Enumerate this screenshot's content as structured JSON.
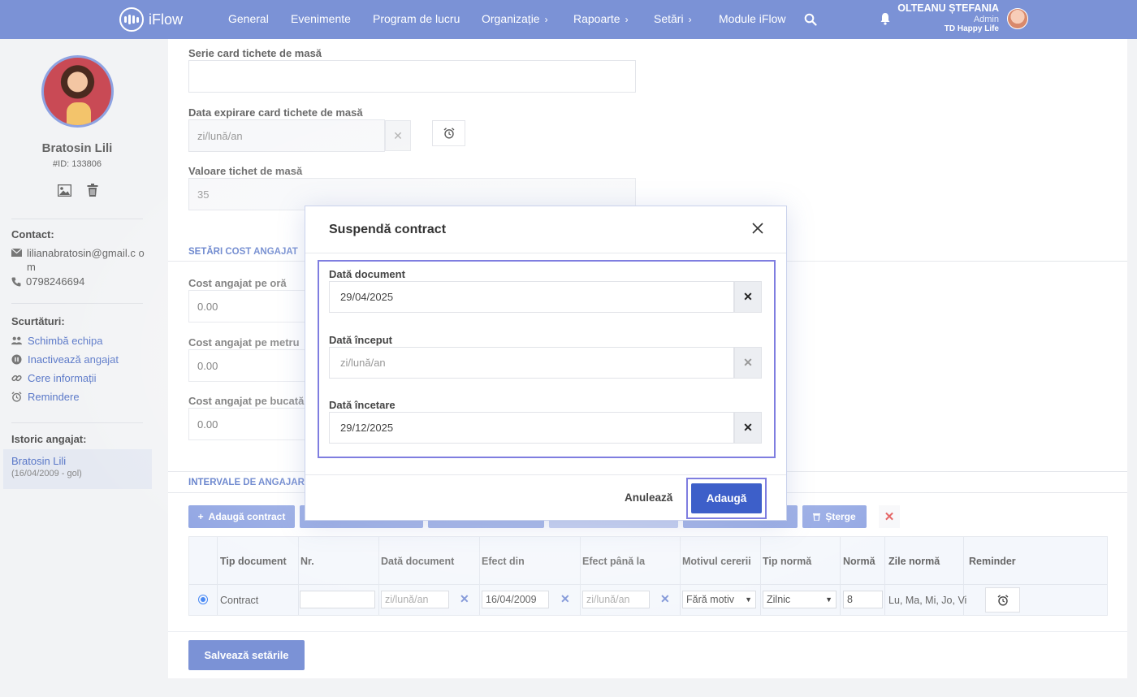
{
  "app": {
    "name": "iFlow"
  },
  "nav": {
    "items": [
      {
        "label": "General"
      },
      {
        "label": "Evenimente"
      },
      {
        "label": "Program de lucru"
      },
      {
        "label": "Organizație"
      },
      {
        "label": "Rapoarte"
      },
      {
        "label": "Setări"
      },
      {
        "label": "Module iFlow"
      }
    ],
    "chevron": "›"
  },
  "user": {
    "name": "OLTEANU ȘTEFANIA",
    "role": "Admin",
    "company": "TD Happy Life"
  },
  "profile": {
    "name": "Bratosin Lili",
    "id": "#ID: 133806",
    "contact_heading": "Contact:",
    "email": "lilianabratosin@gmail.c om",
    "phone": "0798246694",
    "shortcuts_heading": "Scurtături:",
    "shortcuts": [
      {
        "label": "Schimbă echipa",
        "icon": "users-icon"
      },
      {
        "label": "Inactivează angajat",
        "icon": "pause-circle-icon"
      },
      {
        "label": "Cere informații",
        "icon": "link-icon"
      },
      {
        "label": "Remindere",
        "icon": "alarm-icon"
      }
    ],
    "history_heading": "Istoric angajat:",
    "history_name": "Bratosin Lili",
    "history_dates": "(16/04/2009 - gol)"
  },
  "form": {
    "card_series_label": "Serie card tichete de masă",
    "card_series_value": "",
    "card_expiry_label": "Data expirare card tichete de masă",
    "card_expiry_placeholder": "zi/lună/an",
    "ticket_value_label": "Valoare tichet de masă",
    "ticket_value": "35",
    "cost_section_tab": "SETĂRI COST ANGAJAT",
    "cost_hour_label": "Cost angajat pe oră",
    "cost_hour_value": "0.00",
    "cost_meter_label": "Cost angajat pe metru",
    "cost_meter_value": "0.00",
    "cost_piece_label": "Cost angajat pe bucată",
    "cost_piece_value": "0.00",
    "intervals_tab": "INTERVALE DE ANGAJARE",
    "add_contract_label": "Adaugă contract",
    "delete_label": "Șterge",
    "save_label": "Salvează setările"
  },
  "table": {
    "headers": [
      "Tip document",
      "Nr.",
      "Dată document",
      "Efect din",
      "Efect până la",
      "Motivul cererii",
      "Tip normă",
      "Normă",
      "Zile normă",
      "Reminder"
    ],
    "row": {
      "tip_document": "Contract",
      "nr": "",
      "data_document_placeholder": "zi/lună/an",
      "efect_din": "16/04/2009",
      "efect_pana_la_placeholder": "zi/lună/an",
      "motiv": "Fără motiv",
      "tip_norma": "Zilnic",
      "norma": "8",
      "zile_norma": "Lu, Ma, Mi, Jo, Vi"
    }
  },
  "modal": {
    "title": "Suspendă contract",
    "doc_date_label": "Dată document",
    "doc_date_value": "29/04/2025",
    "start_date_label": "Dată început",
    "start_date_placeholder": "zi/lună/an",
    "end_date_label": "Dată încetare",
    "end_date_value": "29/12/2025",
    "cancel_label": "Anulează",
    "add_label": "Adaugă"
  },
  "colors": {
    "topbar": "#7b92d6",
    "primary": "#3d5fc9",
    "highlight": "#7f7ee0",
    "link": "#5a78c8"
  }
}
